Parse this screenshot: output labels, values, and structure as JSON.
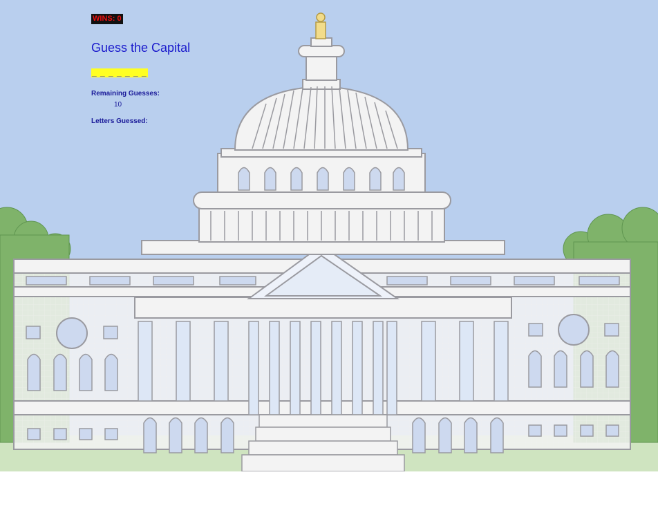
{
  "game": {
    "wins_label": "WINS: 0",
    "title": "Guess the Capital",
    "word_blanks": "_ _ _ _ _ _ _",
    "remaining_label": "Remaining Guesses:",
    "remaining_value": "10",
    "letters_label": "Letters Guessed:",
    "letters_value": ""
  },
  "colors": {
    "sky": "#b9cfee",
    "trees": "#7fb36a",
    "building": "#f3f3f3",
    "wins_bg": "#111111",
    "wins_text": "#ee1111",
    "title": "#1a1acc",
    "blanks_bg": "#ffff22"
  }
}
